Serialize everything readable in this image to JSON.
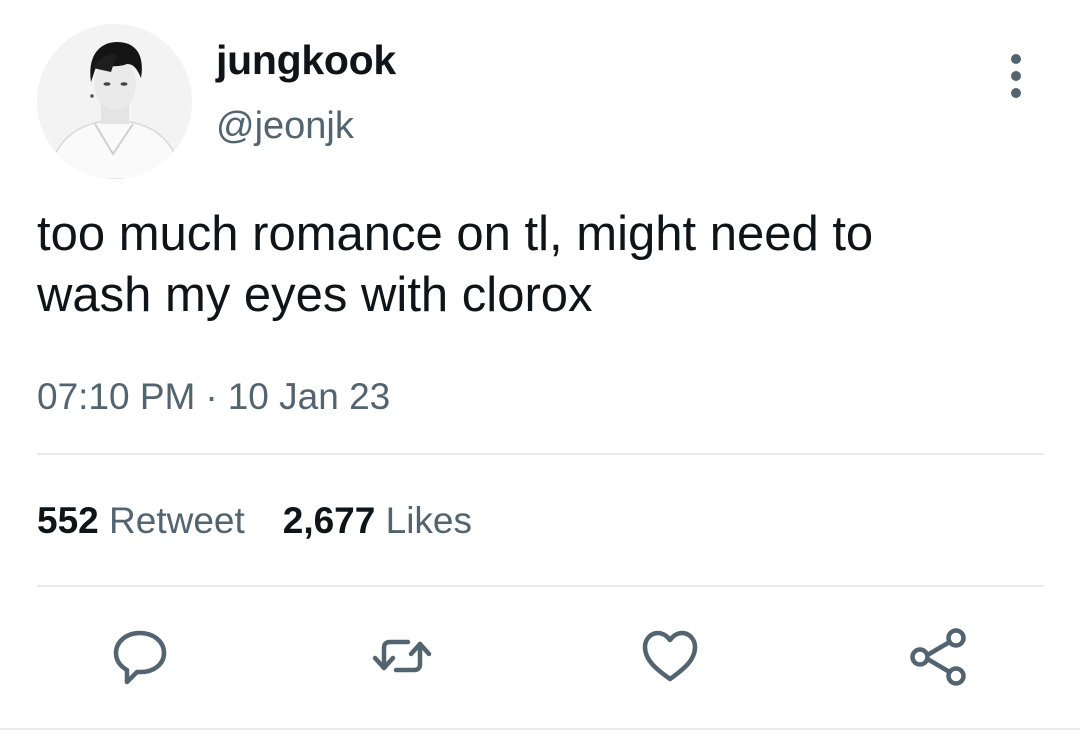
{
  "author": {
    "display_name": "jungkook",
    "handle": "@jeonjk"
  },
  "tweet": {
    "text": "too much romance on tl, might need to\nwash my eyes with clorox",
    "time": "07:10 PM",
    "separator": "·",
    "date": "10 Jan 23"
  },
  "stats": {
    "retweets": {
      "count": "552",
      "label": "Retweet"
    },
    "likes": {
      "count": "2,677",
      "label": "Likes"
    }
  },
  "icons": {
    "more": "more-vertical-icon",
    "reply": "reply-icon",
    "retweet": "retweet-icon",
    "like": "heart-icon",
    "share": "share-icon"
  },
  "colors": {
    "text": "#0f1419",
    "secondary": "#536471",
    "divider": "#e8ecee",
    "background": "#ffffff"
  }
}
